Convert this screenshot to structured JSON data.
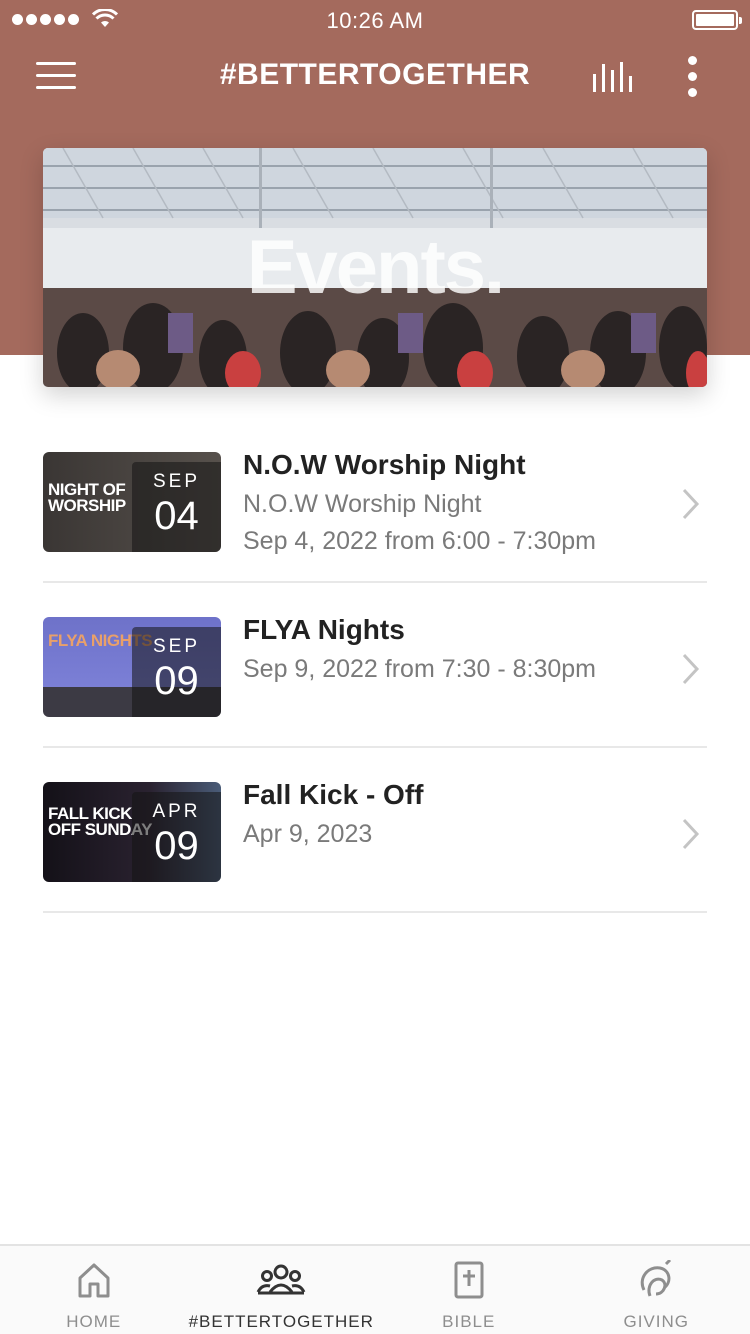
{
  "status_bar": {
    "time": "10:26 AM"
  },
  "header": {
    "title": "#BETTERTOGETHER"
  },
  "banner": {
    "text": "Events."
  },
  "events": [
    {
      "title": "N.O.W Worship Night",
      "subtitle": "N.O.W Worship Night",
      "date_text": "Sep 4, 2022 from 6:00 - 7:30pm",
      "month": "SEP",
      "day": "04",
      "thumb_text": "NIGHT OF WORSHIP"
    },
    {
      "title": "FLYA Nights",
      "date_text": "Sep 9, 2022 from 7:30 - 8:30pm",
      "month": "SEP",
      "day": "09",
      "thumb_text": "FLYA NIGHTS"
    },
    {
      "title": "Fall Kick - Off",
      "date_text": "Apr 9, 2023",
      "month": "APR",
      "day": "09",
      "thumb_text": "FALL KICK OFF SUNDAY"
    }
  ],
  "tabs": [
    {
      "label": "HOME",
      "icon": "home-icon"
    },
    {
      "label": "#BETTERTOGETHER",
      "icon": "group-icon",
      "active": true
    },
    {
      "label": "BIBLE",
      "icon": "bible-icon"
    },
    {
      "label": "GIVING",
      "icon": "giving-icon"
    }
  ],
  "colors": {
    "header": "#a46a5d",
    "tab_active": "#333333",
    "tab_inactive": "#8e8e8e"
  }
}
